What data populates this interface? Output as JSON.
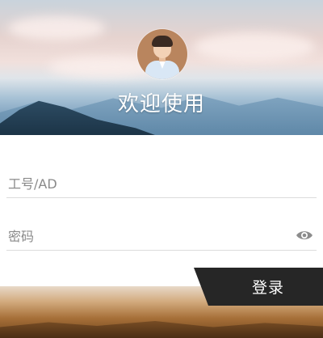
{
  "header": {
    "welcome_text": "欢迎使用",
    "avatar_icon": "user-avatar-icon"
  },
  "form": {
    "username_placeholder": "工号/AD",
    "password_placeholder": "密码",
    "username_value": "",
    "password_value": "",
    "visibility_icon": "eye-icon"
  },
  "actions": {
    "login_label": "登录"
  },
  "colors": {
    "button_bg": "#262626",
    "button_text": "#ffffff",
    "divider": "#dcdcdc",
    "placeholder": "#8a8a8a"
  }
}
